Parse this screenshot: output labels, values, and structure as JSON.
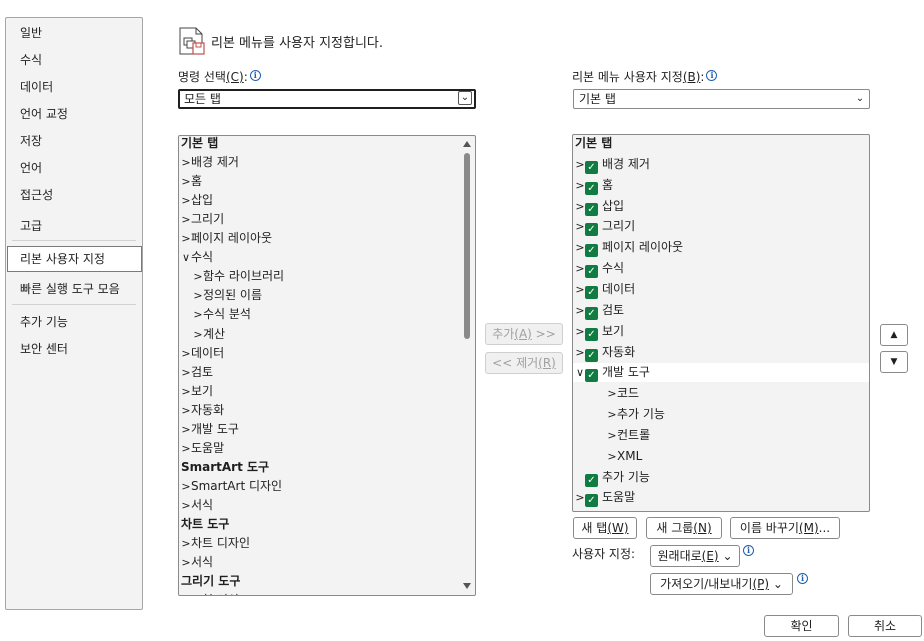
{
  "nav": {
    "items": [
      {
        "label": "일반"
      },
      {
        "label": "수식"
      },
      {
        "label": "데이터"
      },
      {
        "label": "언어 교정"
      },
      {
        "label": "저장"
      },
      {
        "label": "언어"
      },
      {
        "label": "접근성"
      },
      {
        "label": "고급"
      },
      {
        "label": "리본 사용자 지정",
        "selected": true
      },
      {
        "label": "빠른 실행 도구 모음"
      },
      {
        "label": "추가 기능"
      },
      {
        "label": "보안 센터"
      }
    ]
  },
  "header": {
    "icon": "customize-ribbon-icon",
    "title": "리본 메뉴를 사용자 지정합니다."
  },
  "commands": {
    "label": "명령 선택",
    "mnemonic": "(C)",
    "suffix": ":",
    "selected": "모든 탭"
  },
  "ribbon": {
    "label": "리본 메뉴 사용자 지정",
    "mnemonic": "(B)",
    "suffix": ":",
    "selected": "기본 탭"
  },
  "left_list": [
    {
      "text": "기본 탭",
      "type": "header"
    },
    {
      "text": "배경 제거",
      "chev": ">",
      "indent": 0
    },
    {
      "text": "홈",
      "chev": ">",
      "indent": 0
    },
    {
      "text": "삽입",
      "chev": ">",
      "indent": 0
    },
    {
      "text": "그리기",
      "chev": ">",
      "indent": 0
    },
    {
      "text": "페이지 레이아웃",
      "chev": ">",
      "indent": 0
    },
    {
      "text": "수식",
      "chev": "v",
      "indent": 0
    },
    {
      "text": "함수 라이브러리",
      "chev": ">",
      "indent": 1
    },
    {
      "text": "정의된 이름",
      "chev": ">",
      "indent": 1
    },
    {
      "text": "수식 분석",
      "chev": ">",
      "indent": 1
    },
    {
      "text": "계산",
      "chev": ">",
      "indent": 1
    },
    {
      "text": "데이터",
      "chev": ">",
      "indent": 0
    },
    {
      "text": "검토",
      "chev": ">",
      "indent": 0
    },
    {
      "text": "보기",
      "chev": ">",
      "indent": 0
    },
    {
      "text": "자동화",
      "chev": ">",
      "indent": 0
    },
    {
      "text": "개발 도구",
      "chev": ">",
      "indent": 0
    },
    {
      "text": "도움말",
      "chev": ">",
      "indent": 0
    },
    {
      "text": "SmartArt 도구",
      "type": "header"
    },
    {
      "text": "SmartArt 디자인",
      "chev": ">",
      "indent": 0
    },
    {
      "text": "서식",
      "chev": ">",
      "indent": 0
    },
    {
      "text": "차트 도구",
      "type": "header"
    },
    {
      "text": "차트 디자인",
      "chev": ">",
      "indent": 0
    },
    {
      "text": "서식",
      "chev": ">",
      "indent": 0
    },
    {
      "text": "그리기 도구",
      "type": "header"
    },
    {
      "text": "도형 서식",
      "chev": ">",
      "indent": 0
    }
  ],
  "right_list": [
    {
      "text": "기본 탭",
      "type": "header"
    },
    {
      "text": "배경 제거",
      "chev": ">",
      "check": true,
      "indent": 0
    },
    {
      "text": "홈",
      "chev": ">",
      "check": true,
      "indent": 0
    },
    {
      "text": "삽입",
      "chev": ">",
      "check": true,
      "indent": 0
    },
    {
      "text": "그리기",
      "chev": ">",
      "check": true,
      "indent": 0
    },
    {
      "text": "페이지 레이아웃",
      "chev": ">",
      "check": true,
      "indent": 0
    },
    {
      "text": "수식",
      "chev": ">",
      "check": true,
      "indent": 0
    },
    {
      "text": "데이터",
      "chev": ">",
      "check": true,
      "indent": 0
    },
    {
      "text": "검토",
      "chev": ">",
      "check": true,
      "indent": 0
    },
    {
      "text": "보기",
      "chev": ">",
      "check": true,
      "indent": 0
    },
    {
      "text": "자동화",
      "chev": ">",
      "check": true,
      "indent": 0
    },
    {
      "text": "개발 도구",
      "chev": "v",
      "check": true,
      "indent": 0,
      "highlight": true
    },
    {
      "text": "코드",
      "chev": ">",
      "indent": 2
    },
    {
      "text": "추가 기능",
      "chev": ">",
      "indent": 2
    },
    {
      "text": "컨트롤",
      "chev": ">",
      "indent": 2
    },
    {
      "text": "XML",
      "chev": ">",
      "indent": 2
    },
    {
      "text": "추가 기능",
      "chev": "",
      "check": true,
      "indent": 0
    },
    {
      "text": "도움말",
      "chev": ">",
      "check": true,
      "indent": 0
    }
  ],
  "middle": {
    "add_label": "추가",
    "add_mn": "(A)",
    "add_suffix": " >>",
    "remove_prefix": "<< 제거",
    "remove_mn": "(R)"
  },
  "updown": {
    "up": "▲",
    "down": "▼"
  },
  "bottom": {
    "new_tab": "새 탭",
    "new_tab_mn": "(W)",
    "new_group": "새 그룹",
    "new_group_mn": "(N)",
    "rename": "이름 바꾸기",
    "rename_mn": "(M)",
    "rename_suffix": "...",
    "customize_label": "사용자 지정:",
    "reset": "원래대로",
    "reset_mn": "(E)",
    "import_export": "가져오기/내보내기",
    "import_export_mn": "(P)"
  },
  "footer": {
    "ok": "확인",
    "cancel": "취소"
  }
}
